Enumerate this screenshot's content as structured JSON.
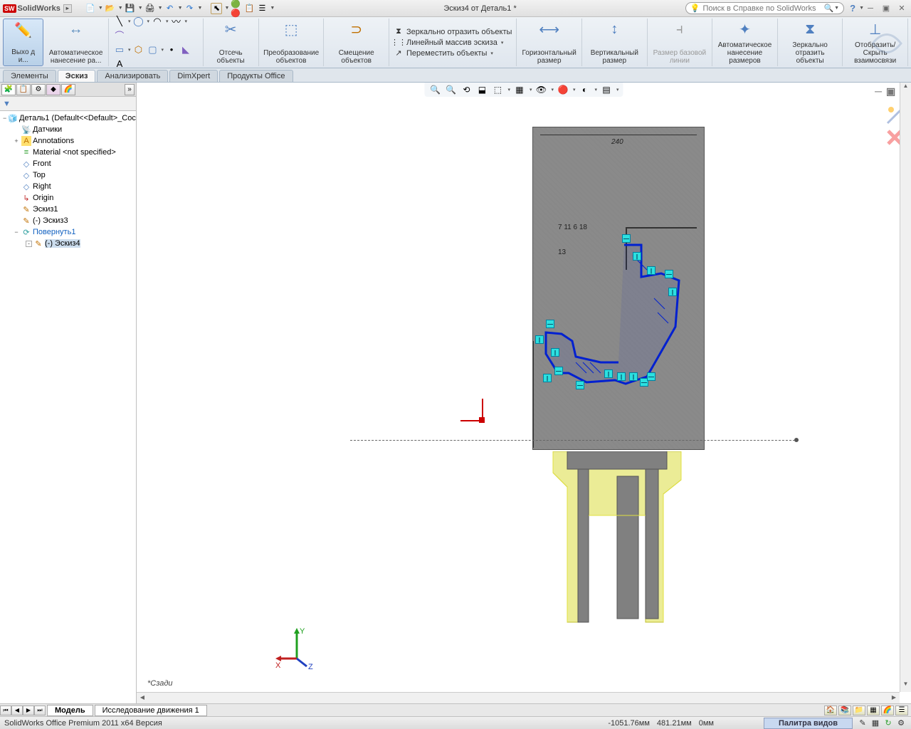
{
  "titlebar": {
    "app": "SolidWorks",
    "document_title": "Эскиз4 от Деталь1 *",
    "search_placeholder": "Поиск в Справке по SolidWorks",
    "help": "?"
  },
  "ribbon": {
    "sketch_exit": "Выхо\nд и...",
    "auto_dim": "Автоматическое нанесение ра...",
    "trim": "Отсечь объекты",
    "convert": "Преобразование объектов",
    "offset": "Смещение объектов",
    "mirror": "Зеркально отразить объекты",
    "linear_pattern": "Линейный массив эскиза",
    "move": "Переместить объекты",
    "hdim": "Горизонтальный размер",
    "vdim": "Вертикальный размер",
    "baseline": "Размер базовой линии",
    "autodim2": "Автоматическое нанесение размеров",
    "mirror2": "Зеркально отразить объекты",
    "showhide": "Отобразить/Скрыть взаимосвязи"
  },
  "tabs": {
    "elements": "Элементы",
    "sketch": "Эскиз",
    "analyze": "Анализировать",
    "dimxpert": "DimXpert",
    "office": "Продукты Office"
  },
  "tree": {
    "root": "Деталь1 (Default<<Default>_Coc",
    "sensors": "Датчики",
    "annotations": "Annotations",
    "material": "Material <not specified>",
    "front": "Front",
    "top": "Top",
    "right": "Right",
    "origin": "Origin",
    "sketch1": "Эскиз1",
    "sketch3": "(-) Эскиз3",
    "revolve": "Повернуть1",
    "sketch4": "(-) Эскиз4"
  },
  "view_annotation": "*Сзади",
  "bottom": {
    "model": "Модель",
    "motion": "Исследование движения 1"
  },
  "status": {
    "version": "SolidWorks Office Premium 2011 x64 Версия",
    "x": "-1051.76мм",
    "y": "481.21мм",
    "z": "0мм",
    "panel": "Палитра видов"
  },
  "triad": {
    "x": "X",
    "y": "Y",
    "z": "Z"
  }
}
